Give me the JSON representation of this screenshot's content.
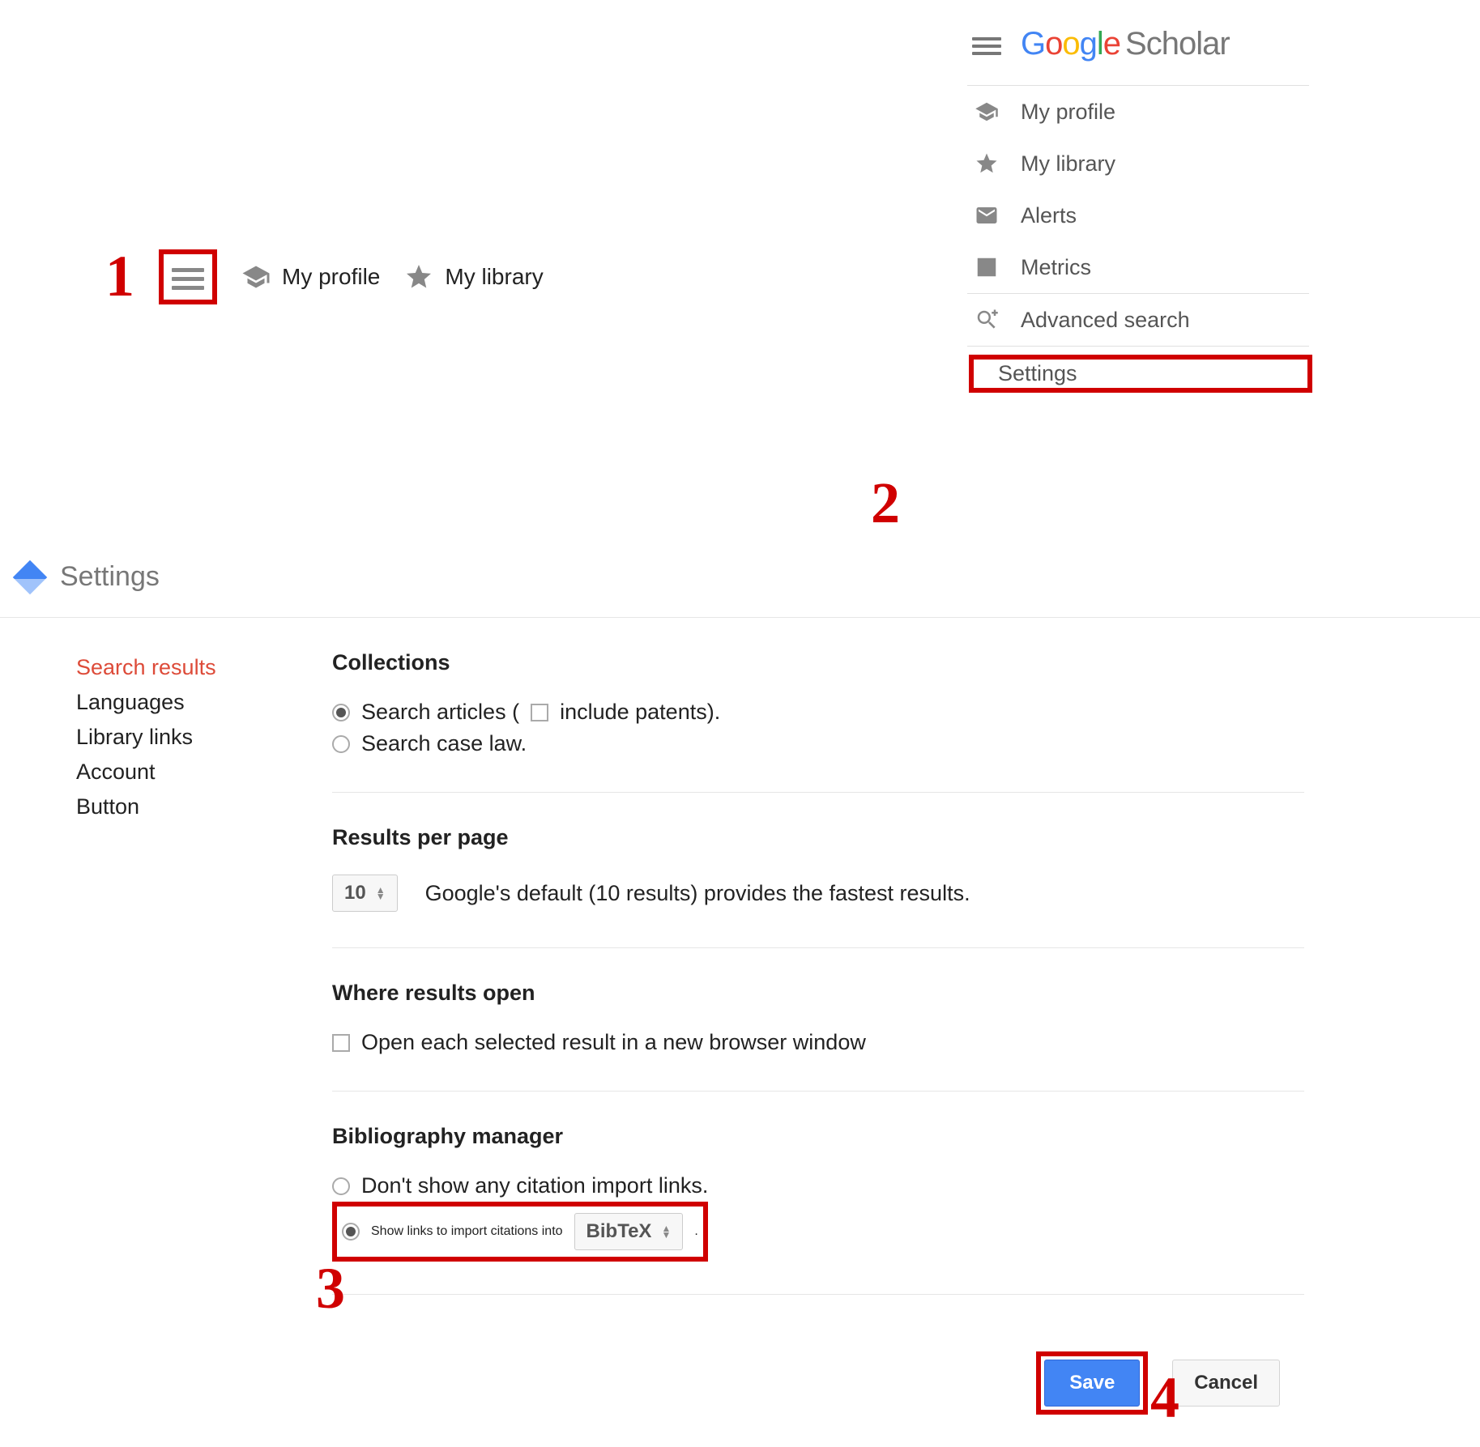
{
  "annotations": {
    "s1": "1",
    "s2": "2",
    "s3": "3",
    "s4": "4"
  },
  "toolbar": {
    "myProfile": "My profile",
    "myLibrary": "My library"
  },
  "logo": {
    "scholar": "Scholar"
  },
  "drop": {
    "myProfile": "My profile",
    "myLibrary": "My library",
    "alerts": "Alerts",
    "metrics": "Metrics",
    "advanced": "Advanced search",
    "settings": "Settings"
  },
  "settingsHeader": "Settings",
  "nav": {
    "searchResults": "Search results",
    "languages": "Languages",
    "libraryLinks": "Library links",
    "account": "Account",
    "button": "Button"
  },
  "collections": {
    "title": "Collections",
    "searchArticles": "Search articles (",
    "includePatents": " include patents).",
    "caseLaw": "Search case law."
  },
  "resultsPerPage": {
    "title": "Results per page",
    "value": "10",
    "hint": "Google's default (10 results) provides the fastest results."
  },
  "whereOpen": {
    "title": "Where results open",
    "option": "Open each selected result in a new browser window"
  },
  "bib": {
    "title": "Bibliography manager",
    "noShow": "Don't show any citation import links.",
    "showLinks": "Show links to import citations into",
    "format": "BibTeX",
    "period": "."
  },
  "buttons": {
    "save": "Save",
    "cancel": "Cancel"
  }
}
